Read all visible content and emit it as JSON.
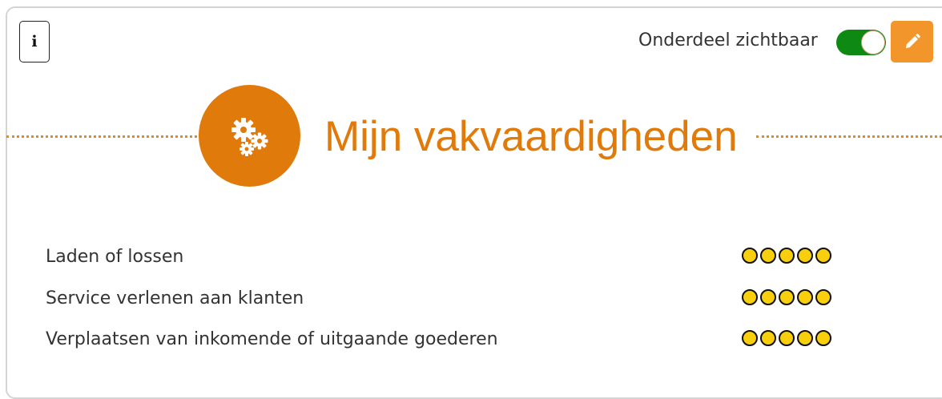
{
  "header": {
    "info_icon_glyph": "i",
    "visibility_label": "Onderdeel zichtbaar",
    "visibility_on": true,
    "toggle_color": "#0e8a14",
    "edit_color": "#f2952b"
  },
  "section": {
    "title": "Mijn vakvaardigheden",
    "icon": "gears-icon",
    "accent_color": "#e07a0b"
  },
  "skills": [
    {
      "label": "Laden of lossen",
      "rating": 5,
      "max": 5
    },
    {
      "label": "Service verlenen aan klanten",
      "rating": 5,
      "max": 5
    },
    {
      "label": "Verplaatsen van inkomende of uitgaande goederen",
      "rating": 5,
      "max": 5
    }
  ]
}
